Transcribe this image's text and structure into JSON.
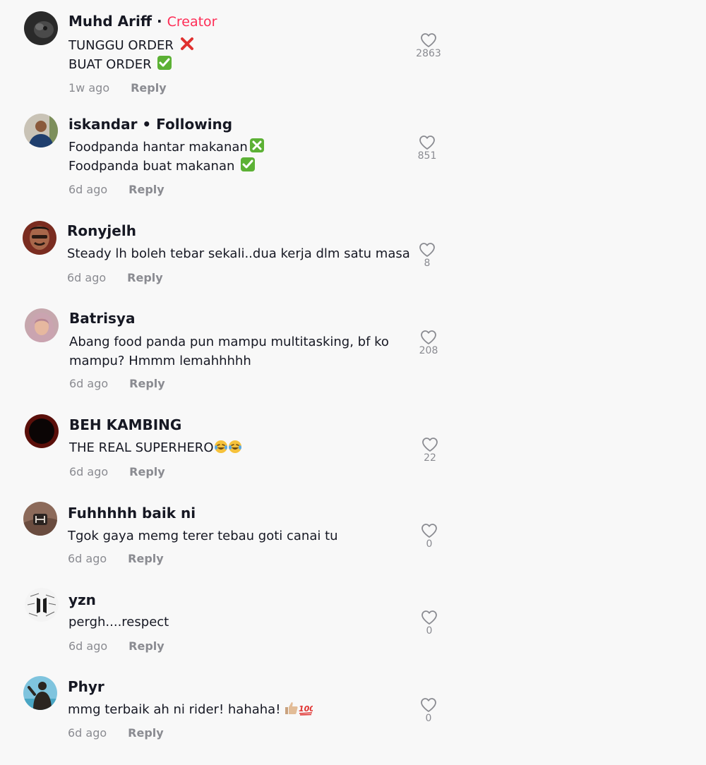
{
  "colors": {
    "background": "#f8f8f8",
    "name": "#161823",
    "creator_badge": "#fe2c55",
    "meta": "#8a8b91"
  },
  "comments": [
    {
      "username": "Muhd Ariff",
      "separator": "·",
      "badge": "Creator",
      "lines": [
        "TUNGGU ORDER",
        "BUAT ORDER"
      ],
      "time": "1w ago",
      "reply": "Reply",
      "likes": "2863",
      "avatar_icon": "dark-pet-avatar"
    },
    {
      "username": "iskandar • Following",
      "lines": [
        "Foodpanda hantar makanan",
        "Foodpanda buat makanan"
      ],
      "time": "6d ago",
      "reply": "Reply",
      "likes": "851",
      "avatar_icon": "person-avatar"
    },
    {
      "username": "Ronyjelh",
      "lines": [
        "Steady lh boleh tebar sekali..dua kerja dlm satu masa"
      ],
      "time": "6d ago",
      "reply": "Reply",
      "likes": "8",
      "avatar_icon": "man-avatar"
    },
    {
      "username": "Batrisya",
      "lines": [
        "Abang food panda pun mampu multitasking, bf ko",
        "mampu? Hmmm lemahhhhh"
      ],
      "time": "6d ago",
      "reply": "Reply",
      "likes": "208",
      "avatar_icon": "hijab-woman-avatar"
    },
    {
      "username": "BEH KAMBING",
      "lines": [
        "THE REAL SUPERHERO"
      ],
      "time": "6d ago",
      "reply": "Reply",
      "likes": "22",
      "avatar_icon": "dark-red-avatar"
    },
    {
      "username": "Fuhhhhh baik ni",
      "lines": [
        "Tgok gaya memg terer tebau goti canai tu"
      ],
      "time": "6d ago",
      "reply": "Reply",
      "likes": "0",
      "avatar_icon": "honda-logo-avatar"
    },
    {
      "username": "yzn",
      "lines": [
        "pergh....respect"
      ],
      "time": "6d ago",
      "reply": "Reply",
      "likes": "0",
      "avatar_icon": "bts-logo-avatar"
    },
    {
      "username": "Phyr",
      "lines": [
        "mmg terbaik ah ni rider! hahaha!"
      ],
      "time": "6d ago",
      "reply": "Reply",
      "likes": "0",
      "avatar_icon": "silhouette-sky-avatar"
    }
  ]
}
